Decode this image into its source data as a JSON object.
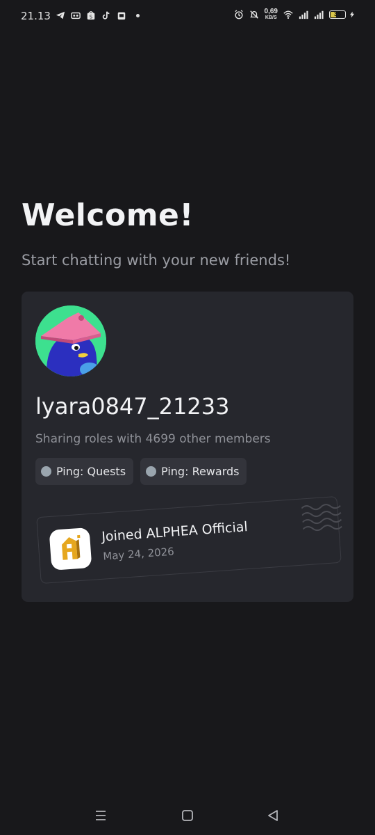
{
  "status_bar": {
    "time": "21.13",
    "net_speed_value": "0,69",
    "net_speed_unit": "KB/S",
    "battery_level": "35",
    "icons_left": [
      "telegram-icon",
      "recorder-icon",
      "shopee-icon",
      "tiktok-icon",
      "app-icon"
    ],
    "icons_right": [
      "alarm-icon",
      "mute-icon",
      "wifi-icon",
      "signal-icon",
      "signal-icon",
      "battery-icon",
      "charging-icon"
    ]
  },
  "main": {
    "title": "Welcome!",
    "subtitle": "Start chatting with your new friends!"
  },
  "card": {
    "username": "lyara0847_21233",
    "sharing_text": "Sharing roles with 4699 other members",
    "roles": [
      {
        "label": "Ping: Quests"
      },
      {
        "label": "Ping: Rewards"
      }
    ],
    "joined": {
      "text": "Joined ALPHEA Official",
      "date": "May 24, 2026"
    }
  },
  "nav": {
    "icons": [
      "menu-icon",
      "home-icon",
      "back-icon"
    ]
  },
  "colors": {
    "background": "#18181b",
    "card": "#26272d",
    "chip": "#33343b",
    "avatar_bg": "#3de08f",
    "server_logo": "#e6a71e"
  }
}
